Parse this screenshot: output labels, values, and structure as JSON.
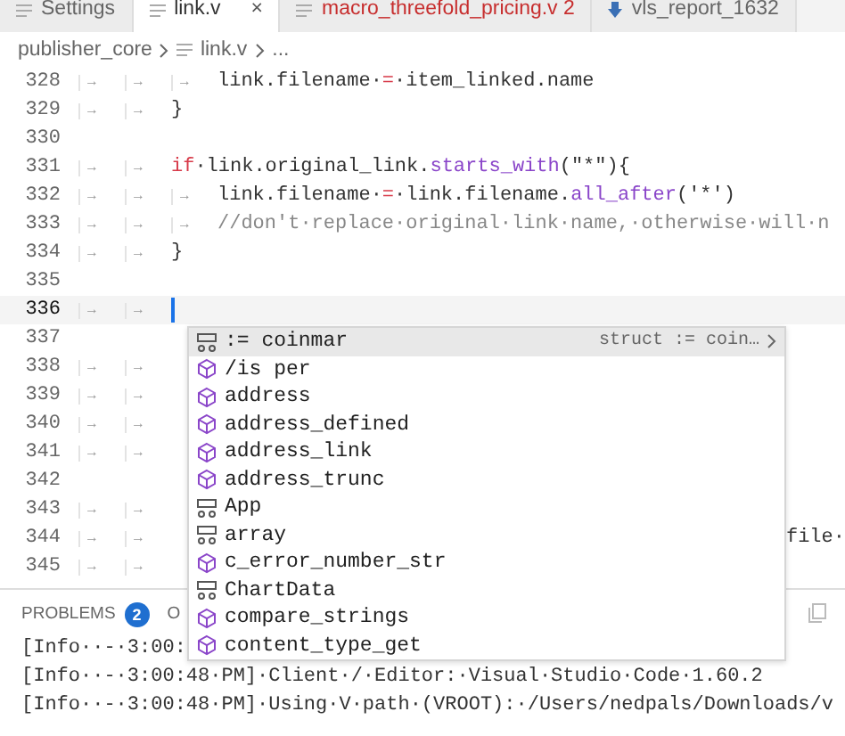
{
  "tabs": [
    {
      "label": "Settings",
      "kind": "file",
      "selected": false,
      "error": false
    },
    {
      "label": "link.v",
      "kind": "file",
      "selected": true,
      "error": false,
      "close": "×"
    },
    {
      "label": "macro_threefold_pricing.v 2",
      "kind": "file",
      "selected": false,
      "error": true
    },
    {
      "label": "vls_report_1632",
      "kind": "download",
      "selected": false,
      "error": false
    }
  ],
  "breadcrumbs": [
    {
      "label": "publisher_core",
      "kind": "folder"
    },
    {
      "label": "link.v",
      "kind": "file"
    },
    {
      "label": "...",
      "kind": "more"
    }
  ],
  "editor": {
    "lines": [
      {
        "number": "328",
        "tabs": [
          "→",
          "→",
          "→"
        ],
        "tokens": [
          {
            "text": "link.filename·",
            "kind": "plain"
          },
          {
            "text": "=",
            "kind": "op"
          },
          {
            "text": "·item_linked.name",
            "kind": "plain"
          }
        ],
        "current": false
      },
      {
        "number": "329",
        "tabs": [
          "→",
          "→"
        ],
        "tokens": [
          {
            "text": "}",
            "kind": "plain"
          }
        ],
        "current": false
      },
      {
        "number": "330",
        "current": false
      },
      {
        "number": "331",
        "tabs": [
          "→",
          "→"
        ],
        "tokens": [
          {
            "text": "if",
            "kind": "keyword"
          },
          {
            "text": "·link.original_link.",
            "kind": "plain"
          },
          {
            "text": "starts_with",
            "kind": "func"
          },
          {
            "text": "(\"*\"){",
            "kind": "plain"
          }
        ],
        "current": false
      },
      {
        "number": "332",
        "tabs": [
          "→",
          "→",
          "→"
        ],
        "tokens": [
          {
            "text": "link.filename·",
            "kind": "plain"
          },
          {
            "text": "=",
            "kind": "op"
          },
          {
            "text": "·link.filename.",
            "kind": "plain"
          },
          {
            "text": "all_after",
            "kind": "func"
          },
          {
            "text": "('*')",
            "kind": "plain"
          }
        ],
        "current": false
      },
      {
        "number": "333",
        "tabs": [
          "→",
          "→",
          "→"
        ],
        "tokens": [
          {
            "text": "//don't·replace·original·link·name,·otherwise·will·n",
            "kind": "comment"
          }
        ],
        "current": false
      },
      {
        "number": "334",
        "tabs": [
          "→",
          "→"
        ],
        "tokens": [
          {
            "text": "}",
            "kind": "plain"
          }
        ],
        "current": false
      },
      {
        "number": "335",
        "current": false
      },
      {
        "number": "336",
        "tabs": [
          "→",
          "→"
        ],
        "current": true
      },
      {
        "number": "337",
        "current": false
      },
      {
        "number": "338",
        "tabs": [
          "→",
          "→"
        ],
        "current": false
      },
      {
        "number": "339",
        "tabs": [
          "→",
          "→"
        ],
        "current": false
      },
      {
        "number": "340",
        "tabs": [
          "→",
          "→"
        ],
        "current": false
      },
      {
        "number": "341",
        "tabs": [
          "→",
          "→"
        ],
        "current": false
      },
      {
        "number": "342",
        "current": false
      },
      {
        "number": "343",
        "tabs": [
          "→",
          "→"
        ],
        "current": false
      },
      {
        "number": "344",
        "tabs": [
          "→",
          "→"
        ],
        "tail": "file·",
        "current": false
      },
      {
        "number": "345",
        "tabs": [
          "→",
          "→"
        ],
        "current": false
      }
    ]
  },
  "suggestions": {
    "items": [
      {
        "kind": "struct",
        "label": ":= coinmar",
        "detail": "struct := coin…",
        "selected": true
      },
      {
        "kind": "field",
        "label": "/is per",
        "selected": false
      },
      {
        "kind": "field",
        "label": "address",
        "selected": false
      },
      {
        "kind": "field",
        "label": "address_defined",
        "selected": false
      },
      {
        "kind": "field",
        "label": "address_link",
        "selected": false
      },
      {
        "kind": "field",
        "label": "address_trunc",
        "selected": false
      },
      {
        "kind": "struct",
        "label": "App",
        "selected": false
      },
      {
        "kind": "struct",
        "label": "array",
        "selected": false
      },
      {
        "kind": "field",
        "label": "c_error_number_str",
        "selected": false
      },
      {
        "kind": "struct",
        "label": "ChartData",
        "selected": false
      },
      {
        "kind": "field",
        "label": "compare_strings",
        "selected": false
      },
      {
        "kind": "field",
        "label": "content_type_get",
        "selected": false
      }
    ]
  },
  "panel": {
    "tabs": [
      {
        "label": "PROBLEMS",
        "badge": "2",
        "selected": false
      },
      {
        "label": "O",
        "selected": false
      }
    ],
    "output": [
      "[Info··-·3:00:",
      "[Info··-·3:00:48·PM]·Client·/·Editor:·Visual·Studio·Code·1.60.2",
      "[Info··-·3:00:48·PM]·Using·V·path·(VROOT):·/Users/nedpals/Downloads/v"
    ]
  }
}
